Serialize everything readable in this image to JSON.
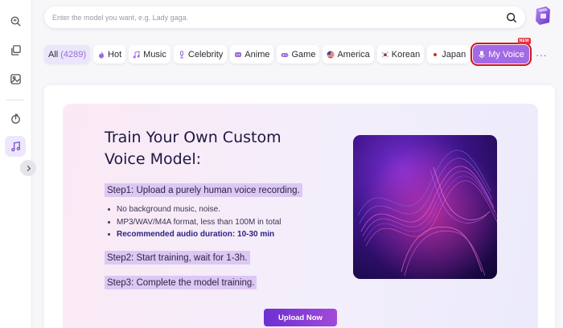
{
  "search": {
    "placeholder": "Enter the model you want, e.g. Lady gaga."
  },
  "sidebar": {
    "items": [
      {
        "icon": "voice-search-icon"
      },
      {
        "icon": "stack-copy-icon"
      },
      {
        "icon": "image-swap-icon"
      },
      {
        "icon": "audio-wave-icon"
      },
      {
        "icon": "music-note-icon",
        "active": true
      }
    ]
  },
  "tabs": {
    "all_label": "All",
    "all_count": "(4289)",
    "hot": "Hot",
    "music": "Music",
    "celebrity": "Celebrity",
    "anime": "Anime",
    "game": "Game",
    "america": "America",
    "korean": "Korean",
    "japan": "Japan",
    "myvoice": "My Voice",
    "myvoice_badge": "NEW",
    "more": "···"
  },
  "main": {
    "title_line1": "Train Your Own Custom",
    "title_line2": "Voice Model:",
    "step1": "Step1: Upload a purely human voice recording.",
    "bullets": [
      "No background music, noise.",
      "MP3/WAV/M4A format, less than 100M in total",
      "Recommended audio duration: 10-30 min"
    ],
    "step2": "Step2: Start training, wait for 1-3h.",
    "step3": "Step3: Complete the model training.",
    "upload_label": "Upload Now"
  },
  "colors": {
    "accent": "#a26ae6",
    "highlight_outline": "#d4141e",
    "step_highlight": "#ddc7f3",
    "button_gradient_start": "#6d2fd0",
    "button_gradient_end": "#a24ad9"
  }
}
